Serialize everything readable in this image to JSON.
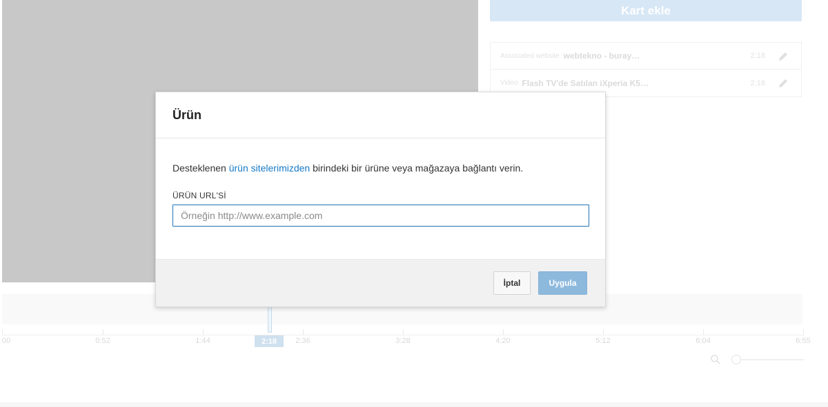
{
  "sidebar": {
    "add_card_label": "Kart ekle",
    "cards": [
      {
        "type": "Associated website",
        "title": "webtekno - buray…",
        "time": "2:18"
      },
      {
        "type": "Video",
        "title": "Flash TV'de Satılan iXperia K5…",
        "time": "2:18"
      }
    ]
  },
  "timeline": {
    "ticks": [
      "00",
      "0:52",
      "1:44",
      "2:36",
      "3:28",
      "4:20",
      "5:12",
      "6:04",
      "6:55"
    ],
    "playhead_time": "2:18"
  },
  "dialog": {
    "title": "Ürün",
    "desc_before": "Desteklenen ",
    "desc_link": "ürün sitelerimizden",
    "desc_after": " birindeki bir ürüne veya mağazaya bağlantı verin.",
    "field_label": "ÜRÜN URL'Sİ",
    "url_value": "",
    "url_placeholder": "Örneğin http://www.example.com",
    "cancel_label": "İptal",
    "apply_label": "Uygula"
  },
  "colors": {
    "accent": "#167ac6",
    "apply_button": "#8db9dd",
    "add_card_button": "#d7e7f5"
  },
  "icons": {
    "edit": "pencil-icon",
    "zoom": "magnifier-icon"
  }
}
